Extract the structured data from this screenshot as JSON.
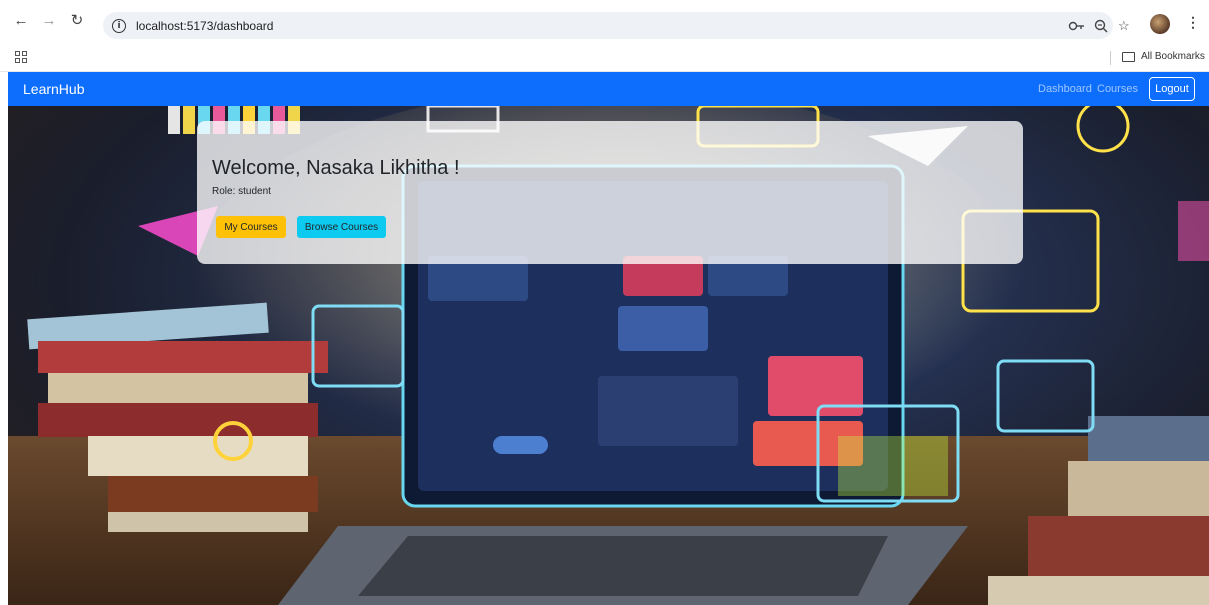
{
  "browser": {
    "url": "localhost:5173/dashboard",
    "bookmarks_label": "All Bookmarks"
  },
  "navbar": {
    "brand": "LearnHub",
    "links": [
      "Dashboard",
      "Courses"
    ],
    "logout_label": "Logout",
    "color": "#0d6efd"
  },
  "welcome_card": {
    "greeting": "Welcome, Nasaka Likhitha !",
    "role": "Role: student",
    "my_courses_label": "My Courses",
    "browse_courses_label": "Browse Courses"
  },
  "colors": {
    "warning": "#ffc107",
    "info": "#0dcaf0"
  }
}
